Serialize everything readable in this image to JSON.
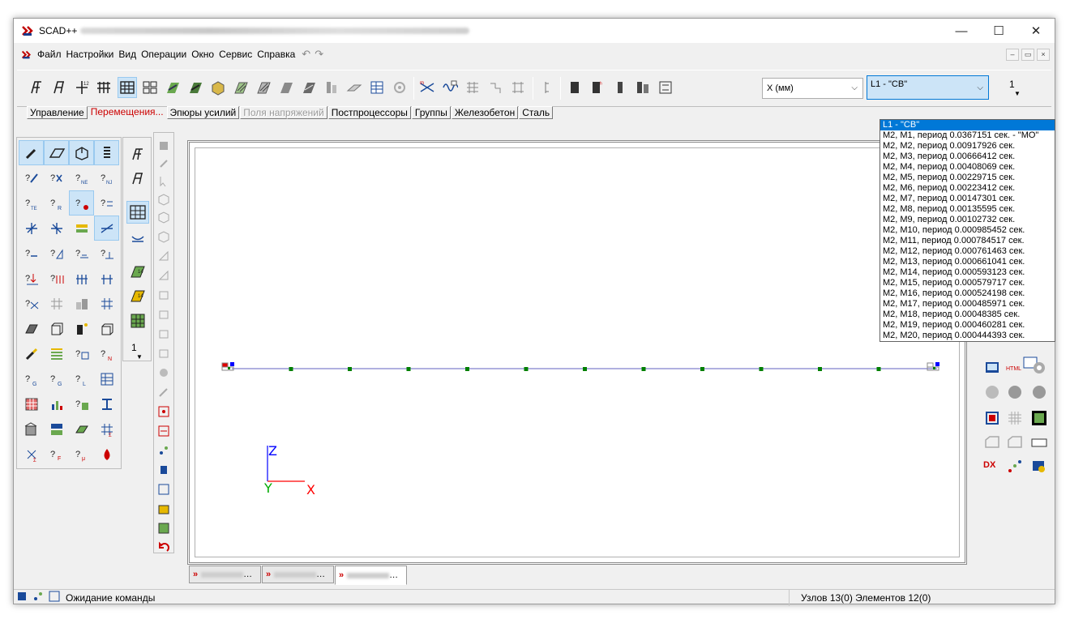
{
  "window": {
    "title": "SCAD++",
    "controls": {
      "minimize": "—",
      "maximize": "☐",
      "close": "✕"
    }
  },
  "menu": {
    "items": [
      "Файл",
      "Настройки",
      "Вид",
      "Операции",
      "Окно",
      "Сервис",
      "Справка"
    ],
    "undo_icon": "undo-icon",
    "redo_icon": "redo-icon",
    "mdi": {
      "minimize": "–",
      "restore": "▭",
      "close": "×"
    }
  },
  "toolbar": {
    "axis_combo": "X (мм)",
    "load_combo": "L1 - \"CB\"",
    "number_field": "1"
  },
  "tabs": [
    {
      "label": "Управление",
      "state": "normal"
    },
    {
      "label": "Перемещения...",
      "state": "active"
    },
    {
      "label": "Эпюры усилий",
      "state": "normal"
    },
    {
      "label": "Поля напряжений",
      "state": "disabled"
    },
    {
      "label": "Постпроцессоры",
      "state": "normal"
    },
    {
      "label": "Группы",
      "state": "normal"
    },
    {
      "label": "Железобетон",
      "state": "normal"
    },
    {
      "label": "Сталь",
      "state": "normal"
    }
  ],
  "dropdown": {
    "items": [
      "L1 - \"CB\"",
      "M2, M1, период 0.0367151 сек. - \"MO\"",
      "M2, M2, период 0.00917926 сек.",
      "M2, M3, период 0.00666412 сек.",
      "M2, M4, период 0.00408069 сек.",
      "M2, M5, период 0.00229715 сек.",
      "M2, M6, период 0.00223412 сек.",
      "M2, M7, период 0.00147301 сек.",
      "M2, M8, период 0.00135595 сек.",
      "M2, M9, период 0.00102732 сек.",
      "M2, M10, период 0.000985452 сек.",
      "M2, M11, период 0.000784517 сек.",
      "M2, M12, период 0.000761463 сек.",
      "M2, M13, период 0.000661041 сек.",
      "M2, M14, период 0.000593123 сек.",
      "M2, M15, период 0.000579717 сек.",
      "M2, M16, период 0.000524198 сек.",
      "M2, M17, период 0.000485971 сек.",
      "M2, M18, период 0.00048385 сек.",
      "M2, M19, период 0.000460281 сек.",
      "M2, M20, период 0.000444393 сек."
    ],
    "selected_index": 0
  },
  "canvas": {
    "axes": {
      "z": "Z",
      "y": "Y",
      "x": "X"
    },
    "node_count": 13,
    "colors": {
      "beam": "#6060c0",
      "node": "#008000",
      "z_axis": "#0000ff",
      "y_axis": "#00aa00",
      "x_axis": "#ff0000"
    }
  },
  "palette": {
    "side_value": "1"
  },
  "right_panel": {
    "dx_label": "DX",
    "html_label": "HTML"
  },
  "doc_tabs": [
    "",
    "",
    ""
  ],
  "status": {
    "message": "Ожидание команды",
    "info": "Узлов 13(0) Элементов 12(0)"
  }
}
